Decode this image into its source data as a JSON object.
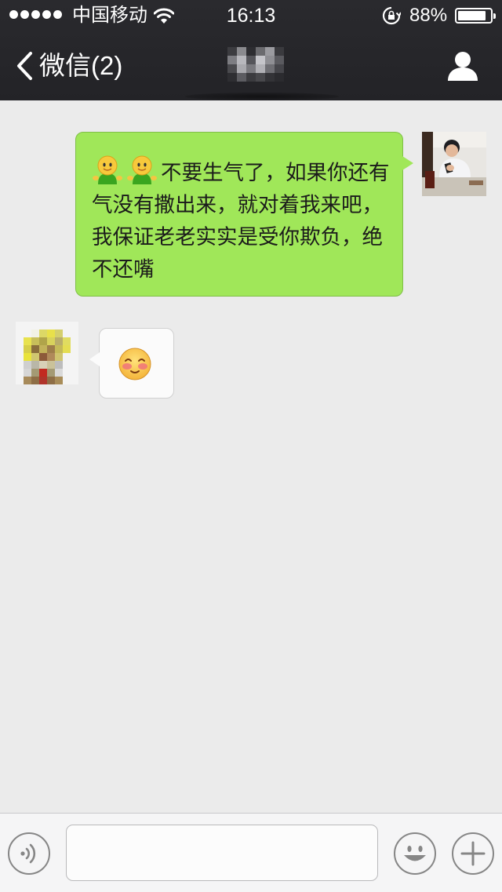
{
  "status_bar": {
    "carrier": "中国移动",
    "time": "16:13",
    "battery_percent": "88%",
    "battery_level": 0.88,
    "signal_bars": 5,
    "icons": [
      "signal-dots-icon",
      "wifi-icon",
      "rotation-lock-icon",
      "battery-icon"
    ]
  },
  "nav": {
    "back_label": "微信(2)",
    "back_icon": "chevron-left-icon",
    "title_pixelated": true,
    "profile_icon": "person-icon"
  },
  "messages": [
    {
      "direction": "outgoing",
      "emoji_prefix": [
        "qq-green-doll-emoji",
        "qq-green-doll-emoji"
      ],
      "text": "不要生气了，如果你还有气没有撒出来，就对着我来吧，我保证老老实实是受你欺负，绝不还嘴",
      "bubble_color": "#a0e759"
    },
    {
      "direction": "incoming",
      "emoji": "blushing-face-emoji",
      "bubble_color": "#fbfbfb"
    }
  ],
  "input_bar": {
    "voice_icon": "voice-icon",
    "text_value": "",
    "emoji_icon": "smiley-icon",
    "more_icon": "plus-icon"
  },
  "colors": {
    "header_bg": "#252529",
    "chat_bg": "#ebebeb",
    "outgoing_bubble": "#a0e759",
    "incoming_bubble": "#fbfbfb"
  }
}
